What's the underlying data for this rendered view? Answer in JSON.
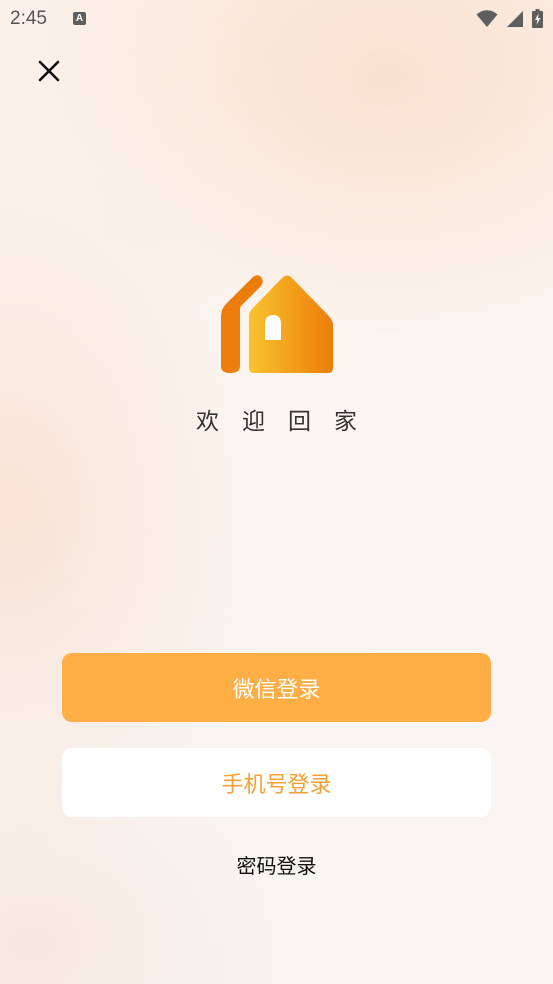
{
  "status_bar": {
    "time": "2:45",
    "notification_icon_letter": "A",
    "icons": [
      "wifi-icon",
      "signal-icon",
      "battery-charging-icon"
    ]
  },
  "header": {
    "close_icon": "close-icon"
  },
  "brand": {
    "logo_icon": "home-logo-icon",
    "welcome_text": "欢迎回家",
    "colors": {
      "logo_dark": "#ec7d0a",
      "logo_light": "#f8c32e"
    }
  },
  "actions": {
    "wechat_login": "微信登录",
    "phone_login": "手机号登录",
    "password_login": "密码登录"
  },
  "colors": {
    "primary_button": "#feae45",
    "secondary_text": "#f2a136"
  }
}
